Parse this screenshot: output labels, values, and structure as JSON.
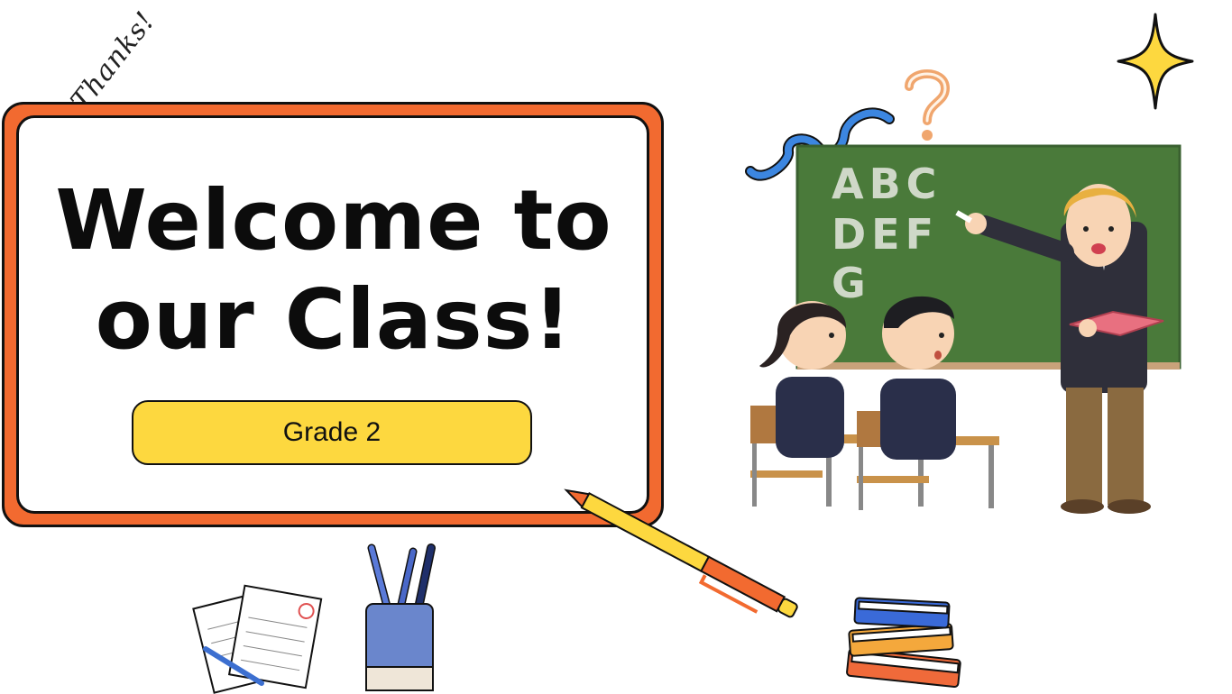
{
  "slide": {
    "title_line1": "Welcome to",
    "title_line2": "our Class!",
    "subtitle_button": "Grade 2",
    "handwritten_note": "Thanks!"
  },
  "chalkboard": {
    "rows": [
      "ABC",
      "DEF",
      "G"
    ]
  },
  "colors": {
    "frame_orange": "#f26a30",
    "pill_yellow": "#fdd83f",
    "chalkboard_green": "#4a7a3a",
    "star_yellow": "#fdd83f"
  },
  "icons": [
    "sparkle-star-icon",
    "question-mark-icon",
    "squiggle-icon",
    "pen-icon",
    "pencil-cup-icon",
    "papers-icon",
    "book-stack-icon",
    "classroom-illustration"
  ]
}
